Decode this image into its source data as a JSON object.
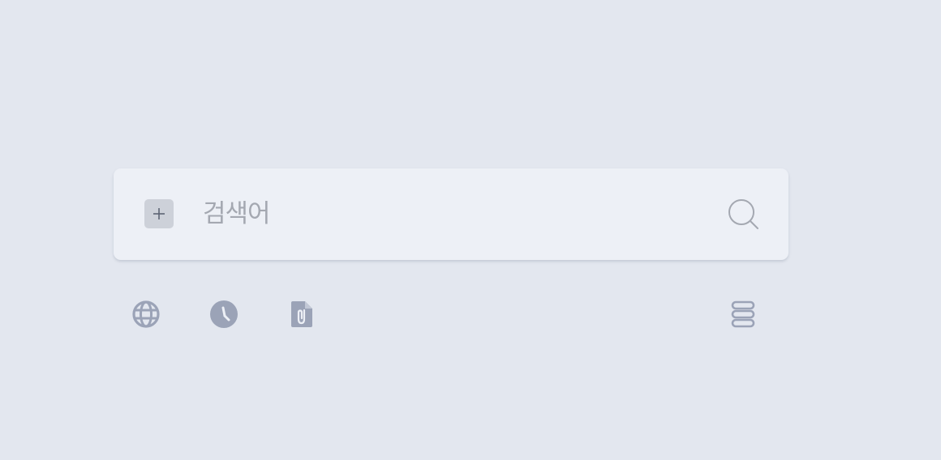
{
  "search": {
    "placeholder": "검색어",
    "value": ""
  },
  "icons": {
    "add": "plus-icon",
    "search": "search-icon",
    "toolbar": [
      "globe-icon",
      "clock-icon",
      "file-attachment-icon",
      "stack-icon"
    ]
  },
  "colors": {
    "background": "#e3e7ef",
    "card": "#edf0f6",
    "icon": "#9ba3b7",
    "placeholder": "#a4a8b1"
  }
}
